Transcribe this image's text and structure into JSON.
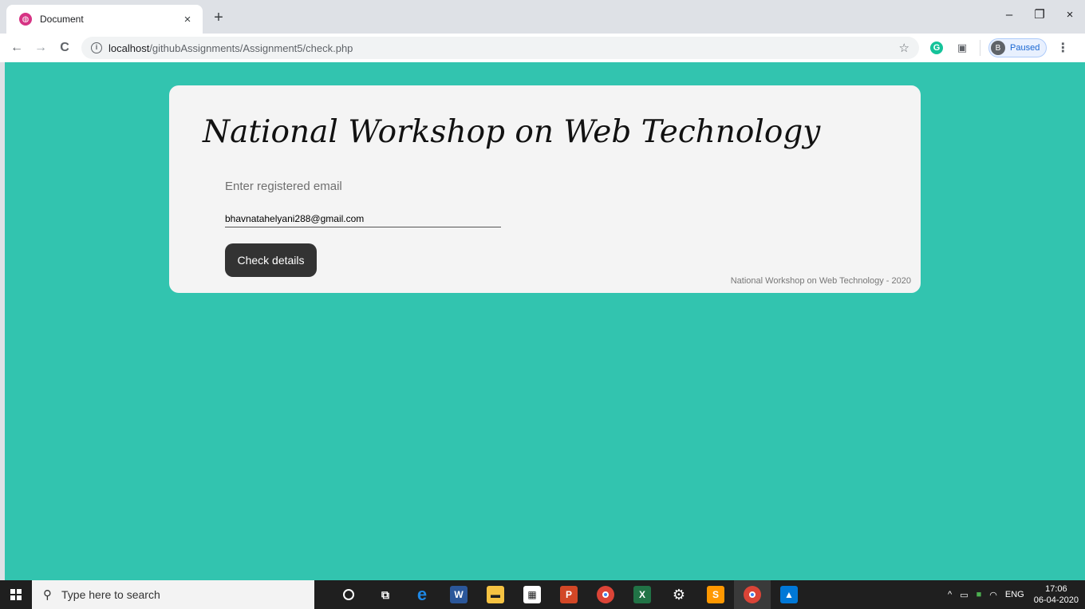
{
  "browser": {
    "tab": {
      "title": "Document",
      "close": "×"
    },
    "new_tab": "+",
    "window": {
      "minimize": "–",
      "restore": "❐",
      "close": "×"
    },
    "nav": {
      "back": "←",
      "forward": "→",
      "reload": "C"
    },
    "url": {
      "host": "localhost",
      "path": "/githubAssignments/Assignment5/check.php"
    },
    "profile": {
      "initial": "B",
      "status": "Paused"
    }
  },
  "page": {
    "heading": "National Workshop on Web Technology",
    "email_label": "Enter registered email",
    "email_value": "bhavnatahelyani288@gmail.com",
    "check_button": "Check details",
    "footer": "National Workshop on Web Technology - 2020",
    "colors": {
      "background": "#32c4af",
      "card": "#f4f4f4",
      "button": "#333333"
    }
  },
  "taskbar": {
    "search_placeholder": "Type here to search",
    "apps": [
      "cortana-icon",
      "task-view-icon",
      "edge-icon",
      "word-icon",
      "file-explorer-icon",
      "store-icon",
      "powerpoint-icon",
      "chrome-icon",
      "excel-icon",
      "settings-icon",
      "sublime-icon",
      "chrome-profile-icon",
      "photos-icon"
    ],
    "tray": {
      "language": "ENG",
      "time": "17:06",
      "date": "06-04-2020"
    }
  }
}
